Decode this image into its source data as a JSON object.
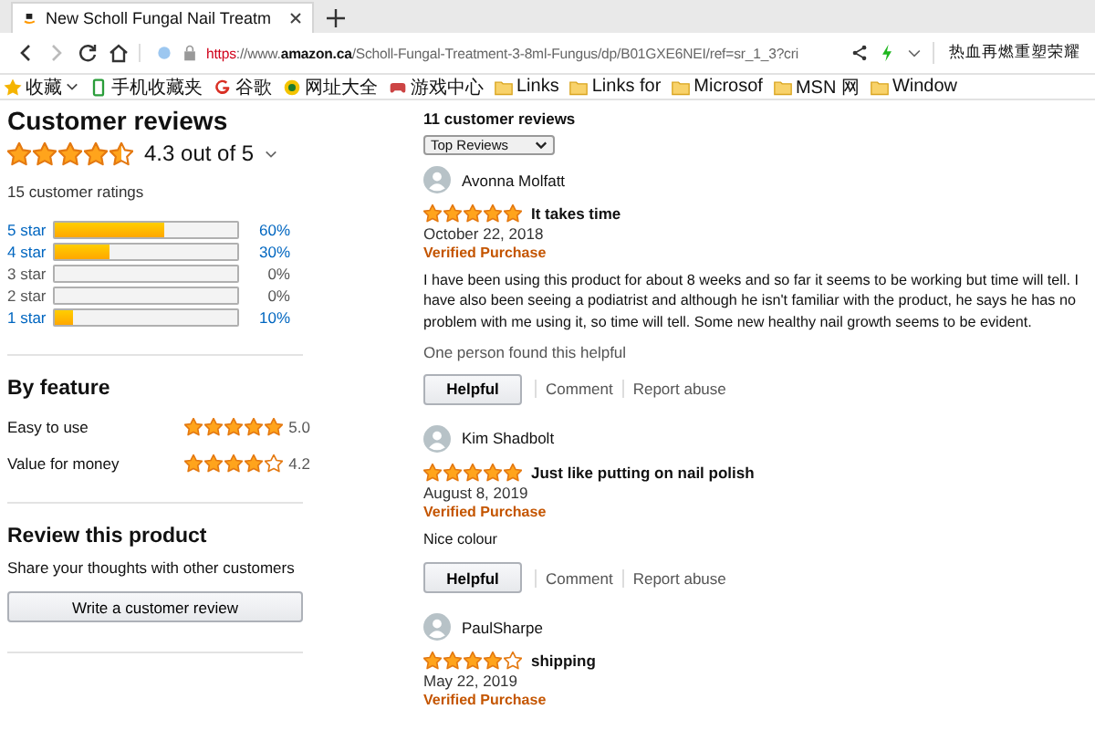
{
  "browser": {
    "tab_title": "New Scholl Fungal Nail Treatm",
    "url": {
      "scheme": "https",
      "rest": "://www.**amazon.ca**/Scholl-Fungal-Treatment-3-8ml-Fungus/dp/B01GXE6NEI/ref=sr_1_3?cri"
    },
    "search_text": "热血再燃重塑荣耀",
    "bookmarks": [
      {
        "label": "收藏",
        "kind": "star"
      },
      {
        "label": "手机收藏夹",
        "kind": "phone"
      },
      {
        "label": "谷歌",
        "kind": "google"
      },
      {
        "label": "网址大全",
        "kind": "globe"
      },
      {
        "label": "游戏中心",
        "kind": "game"
      },
      {
        "label": "Links",
        "kind": "folder"
      },
      {
        "label": "Links for",
        "kind": "folder"
      },
      {
        "label": "Microsof",
        "kind": "folder"
      },
      {
        "label": "MSN 网",
        "kind": "folder"
      },
      {
        "label": "Window",
        "kind": "folder"
      }
    ]
  },
  "summary": {
    "title": "Customer reviews",
    "stars": 4.5,
    "rating": "4.3 out of 5",
    "ratings_count": "15 customer ratings",
    "histogram": [
      {
        "label": "5 star",
        "level": 0.6,
        "percent": "60%",
        "disabled": false
      },
      {
        "label": "4 star",
        "level": 0.3,
        "percent": "30%",
        "disabled": false
      },
      {
        "label": "3 star",
        "percent": "0%",
        "disabled": true
      },
      {
        "label": "2 star",
        "percent": "0%",
        "disabled": true
      },
      {
        "label": "1 star",
        "level": 0.1,
        "percent": "10%",
        "disabled": false
      }
    ]
  },
  "by_feature": {
    "title": "By feature",
    "features": [
      {
        "name": "Easy to use",
        "stars": 5,
        "score": "5.0"
      },
      {
        "name": "Value for money",
        "stars": 4,
        "score": "4.2"
      }
    ]
  },
  "review_product": {
    "title": "Review this product",
    "subtitle": "Share your thoughts with other customers",
    "button": "Write a customer review"
  },
  "reviews_header": {
    "count": "11 customer reviews",
    "sort": "Top Reviews"
  },
  "reviews": [
    {
      "author": "Avonna Molfatt",
      "stars": 5,
      "title": "It takes time",
      "date": "October 22, 2018",
      "badge": "Verified Purchase",
      "body": "I have been using this product for about 8 weeks and so far it seems to be working but time will tell. I have also been seeing a podiatrist and although he isn't familiar with the product, he says he has no problem with me using it, so time will tell. Some new healthy nail growth seems to be evident.",
      "helpful_note": "One person found this helpful",
      "actions": [
        "Helpful",
        "Comment",
        "Report abuse"
      ]
    },
    {
      "author": "Kim Shadbolt",
      "stars": 5,
      "title": "Just like putting on nail polish",
      "date": "August 8, 2019",
      "badge": "Verified Purchase",
      "body": "Nice colour",
      "actions": [
        "Helpful",
        "Comment",
        "Report abuse"
      ]
    },
    {
      "author": "PaulSharpe",
      "stars": 4,
      "title": "shipping",
      "date": "May 22, 2019",
      "badge": "Verified Purchase"
    }
  ]
}
